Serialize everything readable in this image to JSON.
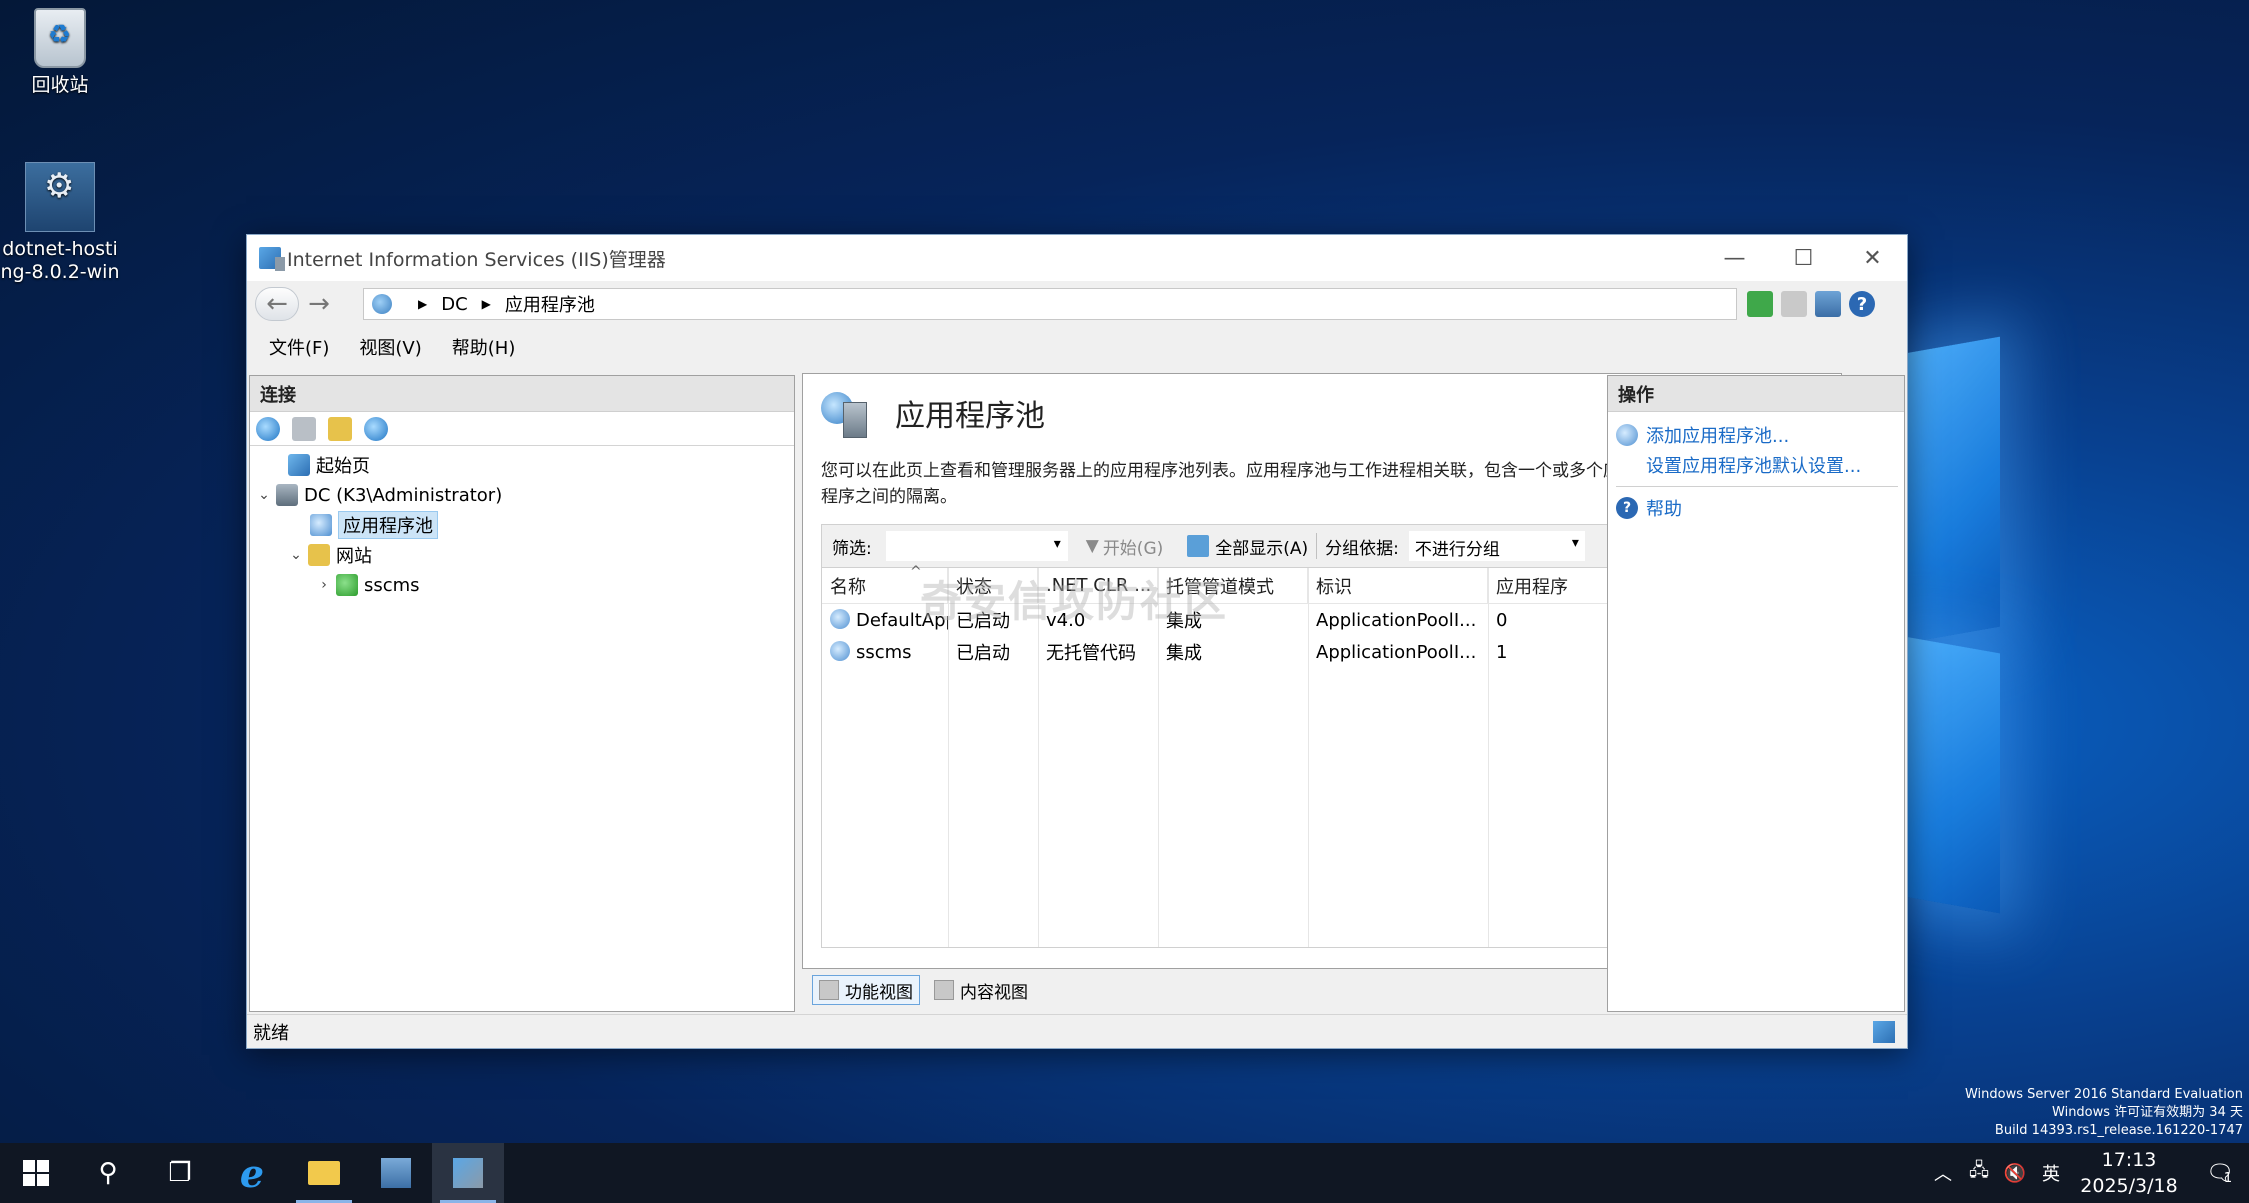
{
  "desktop": {
    "icons": [
      {
        "label": "回收站"
      },
      {
        "label_line1": "dotnet-hosti",
        "label_line2": "ng-8.0.2-win"
      }
    ],
    "os_watermark": {
      "line1": "Windows Server 2016 Standard Evaluation",
      "line2": "Windows 许可证有效期为 34 天",
      "line3": "Build 14393.rs1_release.161220-1747"
    }
  },
  "window": {
    "title": "Internet Information Services (IIS)管理器",
    "controls": {
      "minimize": "—",
      "maximize": "☐",
      "close": "✕"
    },
    "address": {
      "crumbs": [
        "DC",
        "应用程序池"
      ]
    },
    "menu": [
      "文件(F)",
      "视图(V)",
      "帮助(H)"
    ],
    "connections": {
      "header": "连接",
      "tree": [
        {
          "label": "起始页",
          "expander": ""
        },
        {
          "label": "DC (K3\\Administrator)",
          "expander": "⌄"
        },
        {
          "label": "应用程序池",
          "expander": "",
          "selected": true
        },
        {
          "label": "网站",
          "expander": "⌄"
        },
        {
          "label": "sscms",
          "expander": "›"
        }
      ]
    },
    "content": {
      "title": "应用程序池",
      "description": "您可以在此页上查看和管理服务器上的应用程序池列表。应用程序池与工作进程相关联，包含一个或多个应用程序，并提供不同应用程序之间的隔离。",
      "filter_label": "筛选:",
      "start_label": "开始(G)",
      "show_all_label": "全部显示(A)",
      "group_label": "分组依据:",
      "group_value": "不进行分组",
      "columns": [
        "名称",
        "状态",
        ".NET CLR ...",
        "托管管道模式",
        "标识",
        "应用程序"
      ],
      "rows": [
        [
          "DefaultAppPool",
          "已启动",
          "v4.0",
          "集成",
          "ApplicationPoolI...",
          "0"
        ],
        [
          "sscms",
          "已启动",
          "无托管代码",
          "集成",
          "ApplicationPoolI...",
          "1"
        ]
      ],
      "watermark": "奇安信攻防社区"
    },
    "view_tabs": [
      "功能视图",
      "内容视图"
    ],
    "actions": {
      "header": "操作",
      "items": [
        "添加应用程序池...",
        "设置应用程序池默认设置...",
        "帮助"
      ]
    },
    "status": "就绪"
  },
  "taskbar": {
    "ime": "英",
    "time": "17:13",
    "date": "2025/3/18",
    "notification_count": "1"
  }
}
